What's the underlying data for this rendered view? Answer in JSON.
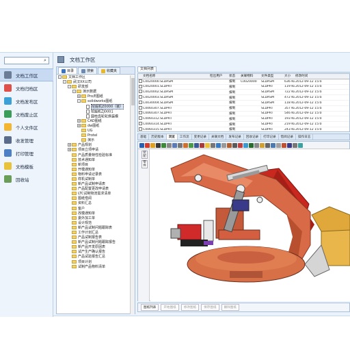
{
  "sidebar": {
    "search": {
      "placeholder": "",
      "value": ""
    },
    "items": [
      {
        "label": "文档工作区",
        "icon": "doc-work-icon",
        "color": "#6a7c96",
        "active": true
      },
      {
        "label": "文档归档区",
        "icon": "doc-archive-icon",
        "color": "#e0504a"
      },
      {
        "label": "文档发布区",
        "icon": "doc-publish-icon",
        "color": "#3aa0d6"
      },
      {
        "label": "文档废止区",
        "icon": "doc-abolish-icon",
        "color": "#3a9d5a"
      },
      {
        "label": "个人文件区",
        "icon": "personal-file-icon",
        "color": "#f2b632"
      },
      {
        "label": "收发管理",
        "icon": "send-receive-icon",
        "color": "#5b6b8c"
      },
      {
        "label": "打印管理",
        "icon": "print-icon",
        "color": "#4c7fc4"
      },
      {
        "label": "文档模板",
        "icon": "template-icon",
        "color": "#e8c23a"
      },
      {
        "label": "回收站",
        "icon": "recycle-bin-icon",
        "color": "#6a9d58"
      }
    ]
  },
  "header": {
    "title": "文档工作区"
  },
  "tree_tabs": [
    {
      "label": "目录",
      "icon": "catalog-icon",
      "color": "#3a74c0"
    },
    {
      "label": "搜索",
      "icon": "search-icon",
      "color": "#6b8bb3"
    },
    {
      "label": "收藏夹",
      "icon": "favorites-icon",
      "color": "#e7b72e"
    }
  ],
  "tree": [
    {
      "d": 0,
      "t": "文档工作区",
      "k": "folder",
      "g": "-"
    },
    {
      "d": 1,
      "t": "武汉XX公司",
      "k": "folder",
      "g": "-"
    },
    {
      "d": 2,
      "t": "研发部",
      "k": "folder",
      "g": "-"
    },
    {
      "d": 3,
      "t": "演示数据",
      "k": "folder",
      "g": "-"
    },
    {
      "d": 4,
      "t": "Pro/E图纸",
      "k": "folder",
      "g": "+"
    },
    {
      "d": 4,
      "t": "solidworks图纸",
      "k": "folder",
      "g": "-"
    },
    {
      "d": 5,
      "t": "挖掘机Z0000（装）",
      "k": "file",
      "sel": true
    },
    {
      "d": 5,
      "t": "挖掘机ZJ0001",
      "k": "file"
    },
    {
      "d": 5,
      "t": "圆柱齿轮轮换装模",
      "k": "file"
    },
    {
      "d": 4,
      "t": "CAD图纸",
      "k": "folder",
      "g": "+"
    },
    {
      "d": 4,
      "t": "dw图纸",
      "k": "folder",
      "g": "+"
    },
    {
      "d": 4,
      "t": "UG",
      "k": "folder"
    },
    {
      "d": 4,
      "t": "Protel",
      "k": "folder"
    },
    {
      "d": 4,
      "t": "演示",
      "k": "folder"
    },
    {
      "d": 2,
      "t": "产品规划",
      "k": "folder",
      "g": "+"
    },
    {
      "d": 2,
      "t": "项目立项申请",
      "k": "folder",
      "g": "+"
    },
    {
      "d": 2,
      "t": "产品质量特性检验标准",
      "k": "folder"
    },
    {
      "d": 2,
      "t": "技术通知单",
      "k": "folder"
    },
    {
      "d": 2,
      "t": "新项目",
      "k": "folder"
    },
    {
      "d": 2,
      "t": "开模通知单",
      "k": "folder"
    },
    {
      "d": 2,
      "t": "物料申请记录表",
      "k": "folder"
    },
    {
      "d": 2,
      "t": "样机试制单",
      "k": "folder"
    },
    {
      "d": 2,
      "t": "新产品试制申请表",
      "k": "folder"
    },
    {
      "d": 2,
      "t": "产品配置更改申请表",
      "k": "folder"
    },
    {
      "d": 2,
      "t": "LTC试制物流需求清单",
      "k": "folder"
    },
    {
      "d": 2,
      "t": "图纸借阅",
      "k": "folder"
    },
    {
      "d": 2,
      "t": "资料汇总",
      "k": "folder"
    },
    {
      "d": 2,
      "t": "客户",
      "k": "folder"
    },
    {
      "d": 2,
      "t": "改模通知单",
      "k": "folder"
    },
    {
      "d": 2,
      "t": "委外加工单",
      "k": "folder"
    },
    {
      "d": 2,
      "t": "设计规范",
      "k": "folder"
    },
    {
      "d": 2,
      "t": "新产品试制问题跟踪表",
      "k": "folder"
    },
    {
      "d": 2,
      "t": "工作计划汇总",
      "k": "folder"
    },
    {
      "d": 2,
      "t": "产品试制报告表",
      "k": "folder"
    },
    {
      "d": 2,
      "t": "新产品试制问题跟踪报告",
      "k": "folder"
    },
    {
      "d": 2,
      "t": "新产品开发原因表",
      "k": "folder"
    },
    {
      "d": 2,
      "t": "试产生产确认报告",
      "k": "folder"
    },
    {
      "d": 2,
      "t": "产品试验报告汇总",
      "k": "folder"
    },
    {
      "d": 2,
      "t": "项目计划",
      "k": "folder"
    },
    {
      "d": 2,
      "t": "试制产品物料清单",
      "k": "folder"
    }
  ],
  "list": {
    "tab": "文档列表",
    "columns": [
      "文档名称",
      "检出用户",
      "状态",
      "关联物料",
      "文件类型",
      "大小",
      "修改时间"
    ],
    "rows": [
      [
        "C0020000.SLDASM",
        "",
        "报制",
        "C0020000",
        "SLDASM",
        "636 KB",
        "2012-09-12 15:04:25"
      ],
      [
        "C0020001.SLDPRT",
        "",
        "报制",
        "",
        "SLDPRT",
        "119 KB",
        "2012-09-12 15:04:25"
      ],
      [
        "C0020002.SLDASM",
        "",
        "报制",
        "",
        "SLDASM",
        "722 KB",
        "2012-09-12 15:04:25"
      ],
      [
        "C0020003.SLDASM",
        "",
        "报制",
        "",
        "SLDASM",
        "472 KB",
        "2012-09-12 15:04:25"
      ],
      [
        "C0030004.SLDASM",
        "",
        "报制",
        "",
        "SLDASM",
        "118 KB",
        "2012-09-12 15:04:25"
      ],
      [
        "C0060307.SLDPRT",
        "",
        "报制",
        "",
        "SLDPRT",
        "357 KB",
        "2012-09-12 15:04:25"
      ],
      [
        "C0060307.SLDPRT",
        "",
        "报制",
        "",
        "SLDPRT",
        "546 KB",
        "2012-09-12 15:04:25"
      ],
      [
        "C0060312.SLDPRT",
        "",
        "报制",
        "",
        "SLDPRT",
        "193 KB",
        "2012-09-12 15:04:25"
      ],
      [
        "C0060314.SLDPRT",
        "",
        "报制",
        "",
        "SLDPRT",
        "219 KB",
        "2012-09-12 15:04:25"
      ],
      [
        "C0060315.SLDPRT",
        "",
        "报制",
        "",
        "SLDPRT",
        "243 KB",
        "2012-09-12 15:04:25"
      ]
    ]
  },
  "viewer_tabs": [
    "基础",
    "历史版本",
    "浏览",
    "工作流",
    "变更记录",
    "关联文档",
    "发布记录",
    "回收记录",
    "打印记录",
    "借阅记录",
    "操作日志"
  ],
  "viewer_tab_active": 2,
  "viewer_side": [
    "装配",
    "零件"
  ],
  "bottom_buttons": [
    {
      "label": "图纸列表",
      "on": true
    },
    {
      "label": "开始图纸",
      "on": false
    },
    {
      "label": "修改图纸",
      "on": false
    },
    {
      "label": "保存图纸",
      "on": false
    },
    {
      "label": "删除图纸",
      "on": false
    }
  ],
  "colors": {
    "accent": "#c7daf1",
    "model_orange": "#d96a48",
    "model_red": "#c8281e",
    "model_yellow": "#e8b64a"
  }
}
